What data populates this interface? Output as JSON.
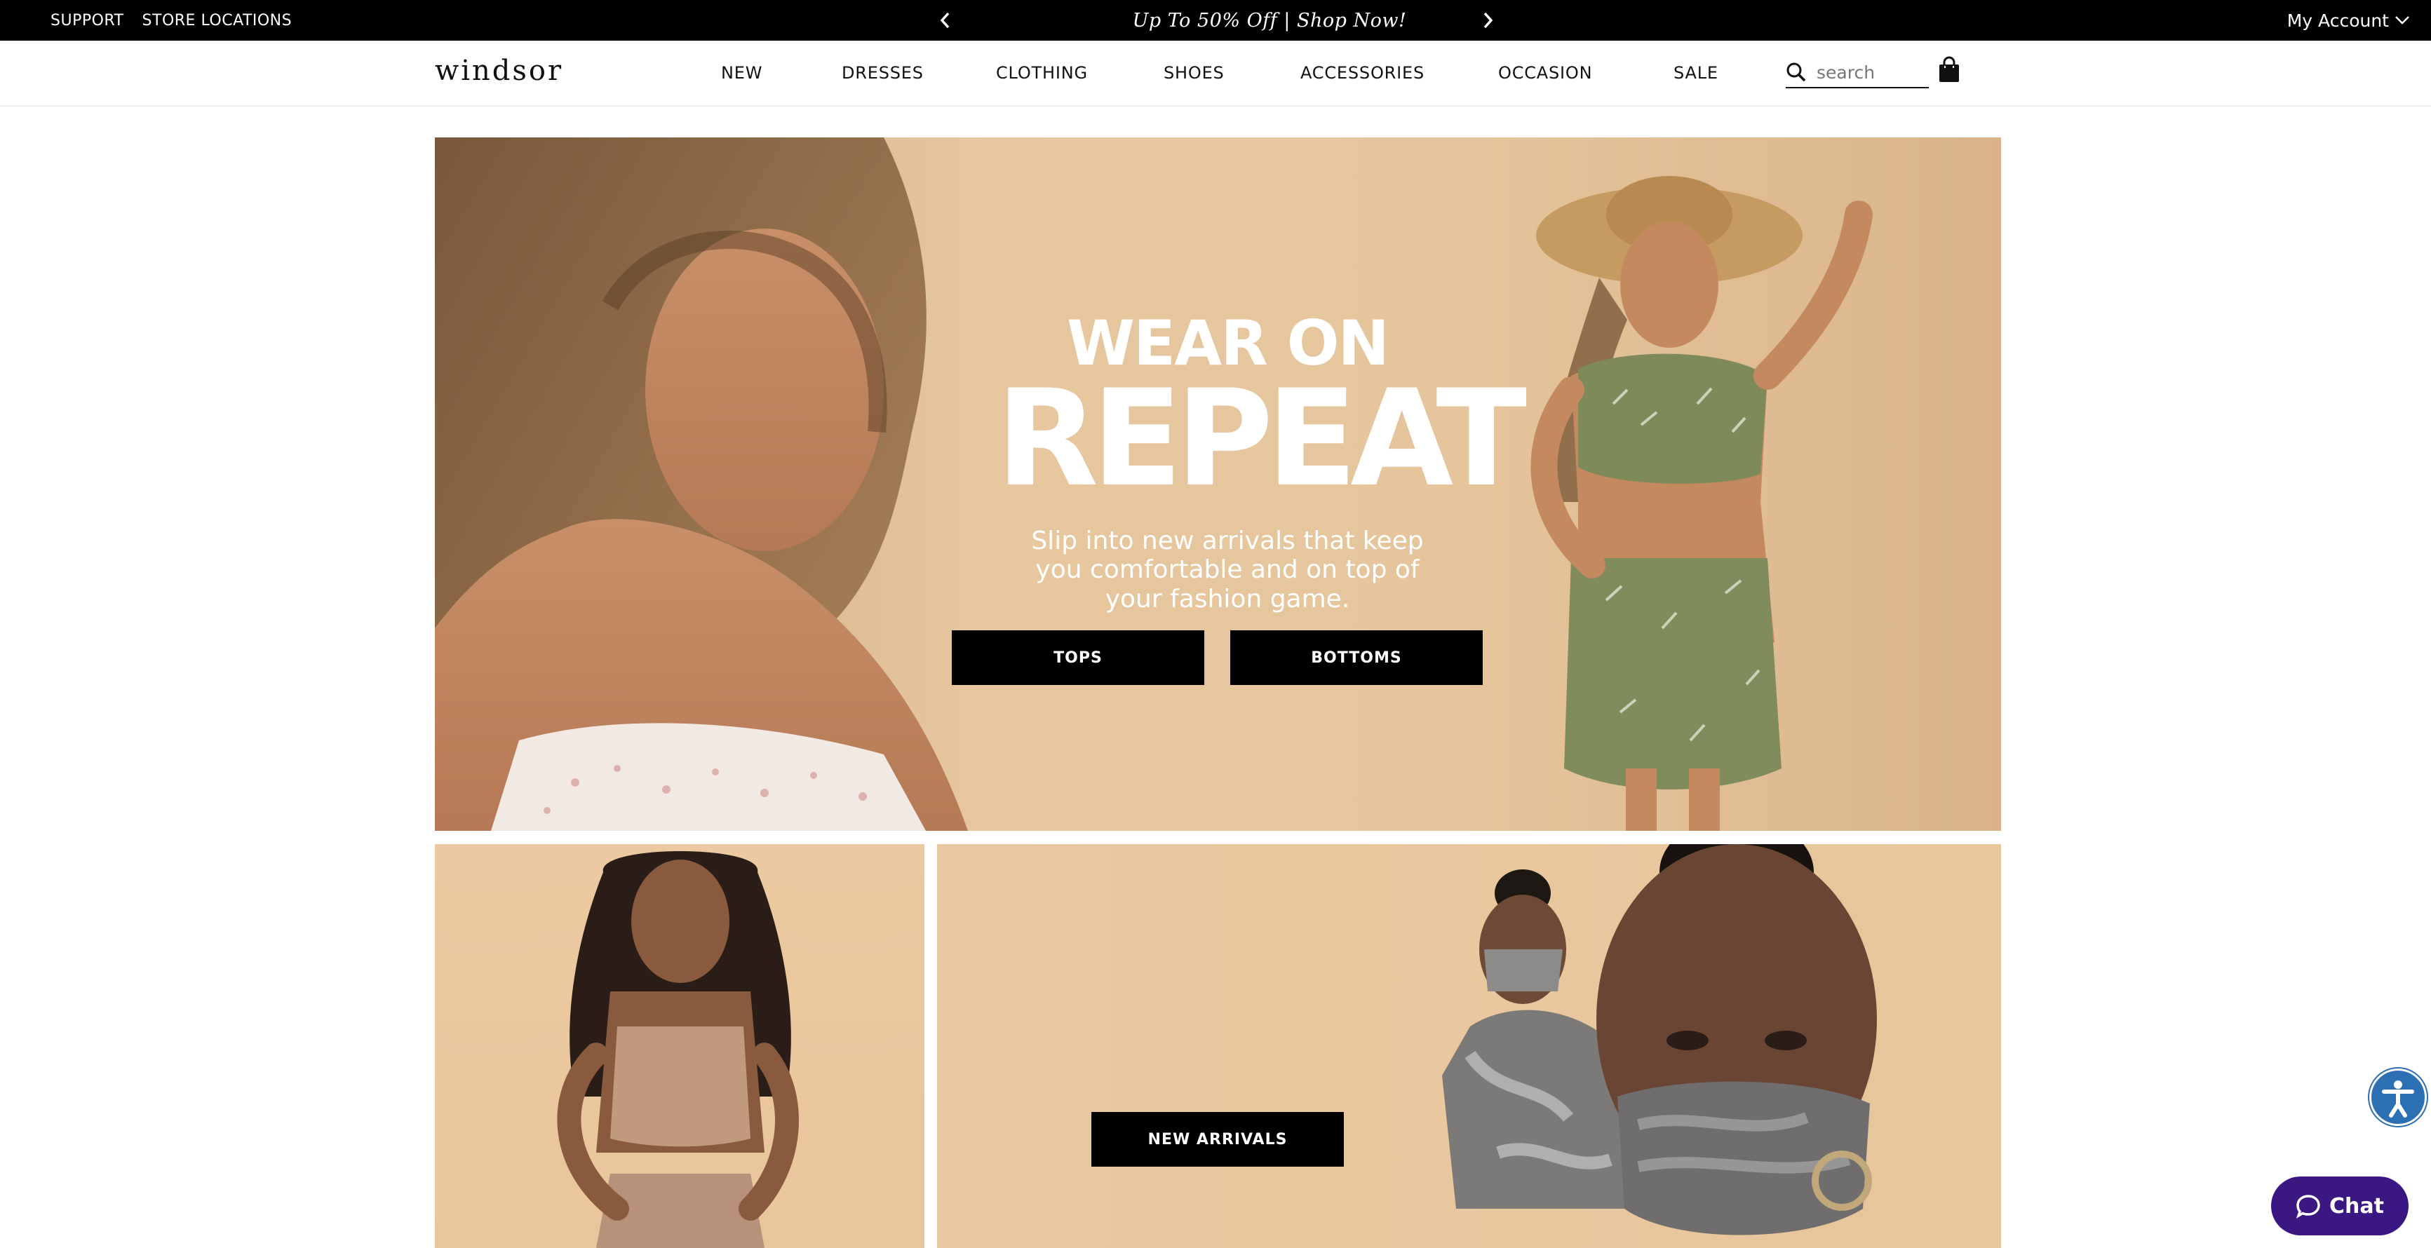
{
  "topbar": {
    "links": [
      "SUPPORT",
      "STORE LOCATIONS"
    ],
    "promo": "Up To 50% Off | Shop Now!",
    "account": "My Account"
  },
  "nav": {
    "logo": "windsor",
    "items": [
      "NEW",
      "DRESSES",
      "CLOTHING",
      "SHOES",
      "ACCESSORIES",
      "OCCASION",
      "SALE"
    ],
    "search_placeholder": "search"
  },
  "hero": {
    "kicker": "WEAR ON",
    "headline": "REPEAT",
    "subtext": "Slip into new arrivals that keep you comfortable and on top of your fashion game.",
    "buttons": [
      "TOPS",
      "BOTTOMS"
    ]
  },
  "tiles": {
    "new_arrivals_button": "NEW ARRIVALS"
  },
  "widgets": {
    "chat_label": "Chat"
  },
  "colors": {
    "topbar_bg": "#000000",
    "hero_bg": "#e7c79f",
    "chat_bg": "#3b1782",
    "accessibility_bg": "#2c6fb3"
  }
}
